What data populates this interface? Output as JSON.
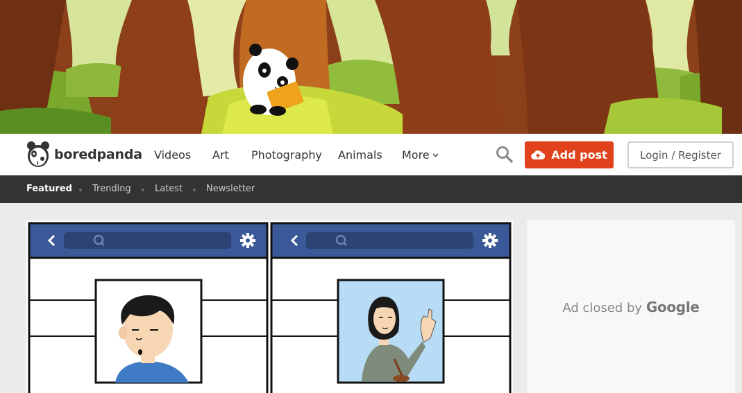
{
  "brand": {
    "name": "boredpanda"
  },
  "nav": {
    "links": [
      "Videos",
      "Art",
      "Photography",
      "Animals",
      "More"
    ],
    "add_post": "Add post",
    "login": "Login / Register"
  },
  "subnav": {
    "items": [
      "Featured",
      "Trending",
      "Latest",
      "Newsletter"
    ],
    "active": "Featured"
  },
  "ad": {
    "prefix": "Ad closed by",
    "brand": "Google"
  },
  "icons": [
    "panda-logo-icon",
    "chevron-down-icon",
    "search-icon",
    "cloud-upload-icon",
    "back-arrow-icon",
    "gear-icon"
  ],
  "colors": {
    "accent": "#e1421b",
    "subnav_bg": "#333333",
    "comic_header": "#3b5998"
  }
}
